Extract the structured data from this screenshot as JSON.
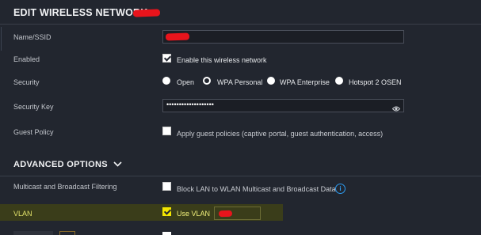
{
  "header": {
    "title": "EDIT WIRELESS NETWORK - "
  },
  "fields": {
    "ssid": {
      "label": "Name/SSID",
      "value": ""
    },
    "enabled": {
      "label": "Enabled",
      "checkbox_label": "Enable this wireless network",
      "checked": true
    },
    "security": {
      "label": "Security",
      "options": [
        "Open",
        "WPA Personal",
        "WPA Enterprise",
        "Hotspot 2 OSEN"
      ],
      "selected": "WPA Personal"
    },
    "security_key": {
      "label": "Security Key",
      "value": "•••••••••••••••••••"
    },
    "guest_policy": {
      "label": "Guest Policy",
      "checkbox_label": "Apply guest policies (captive portal, guest authentication, access)",
      "checked": false
    }
  },
  "advanced": {
    "title": "ADVANCED OPTIONS",
    "multicast": {
      "label": "Multicast and Broadcast Filtering",
      "checkbox_label": "Block LAN to WLAN Multicast and Broadcast Data",
      "checked": false
    },
    "vlan": {
      "label": "VLAN",
      "checkbox_label": "Use VLAN",
      "checked": true,
      "value": ""
    }
  },
  "icons": {
    "eye": "eye-icon",
    "chevron": "chevron-down-icon",
    "info": "info-icon"
  },
  "colors": {
    "background": "#22262f",
    "highlight": "#3a3d1a",
    "info": "#2d9bf0",
    "redaction": "#e8141c"
  }
}
